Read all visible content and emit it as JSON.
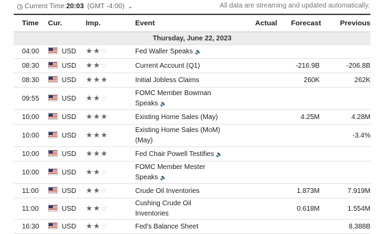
{
  "topbar": {
    "time_label": "Current Time:",
    "time_value": "20:03",
    "timezone": "(GMT -4:00)",
    "chevron": "⌄",
    "notice": "All data are streaming and updated automatically."
  },
  "table": {
    "headers": [
      "Time",
      "Cur.",
      "Imp.",
      "Event",
      "Actual",
      "Forecast",
      "Previous"
    ],
    "date": "Thursday, June 22, 2023",
    "rows": [
      {
        "time": "04:00",
        "cur": "USD",
        "imp": 2,
        "event": "Fed Waller Speaks",
        "speech": true,
        "actual": "",
        "forecast": "",
        "previous": ""
      },
      {
        "time": "08:30",
        "cur": "USD",
        "imp": 2,
        "event": "Current Account (Q1)",
        "speech": false,
        "actual": "",
        "forecast": "-216.9B",
        "previous": "-206.8B"
      },
      {
        "time": "08:30",
        "cur": "USD",
        "imp": 3,
        "event": "Initial Jobless Claims",
        "speech": false,
        "actual": "",
        "forecast": "260K",
        "previous": "262K"
      },
      {
        "time": "09:55",
        "cur": "USD",
        "imp": 2,
        "event": "FOMC Member Bowman Speaks",
        "speech": true,
        "actual": "",
        "forecast": "",
        "previous": ""
      },
      {
        "time": "10:00",
        "cur": "USD",
        "imp": 3,
        "event": "Existing Home Sales (May)",
        "speech": false,
        "actual": "",
        "forecast": "4.25M",
        "previous": "4.28M"
      },
      {
        "time": "10:00",
        "cur": "USD",
        "imp": 3,
        "event": "Existing Home Sales (MoM) (May)",
        "speech": false,
        "actual": "",
        "forecast": "",
        "previous": "-3.4%"
      },
      {
        "time": "10:00",
        "cur": "USD",
        "imp": 3,
        "event": "Fed Chair Powell Testifies",
        "speech": true,
        "actual": "",
        "forecast": "",
        "previous": ""
      },
      {
        "time": "10:00",
        "cur": "USD",
        "imp": 2,
        "event": "FOMC Member Mester Speaks",
        "speech": true,
        "actual": "",
        "forecast": "",
        "previous": ""
      },
      {
        "time": "11:00",
        "cur": "USD",
        "imp": 2,
        "event": "Crude Oil Inventories",
        "speech": false,
        "actual": "",
        "forecast": "1.873M",
        "previous": "7.919M"
      },
      {
        "time": "11:00",
        "cur": "USD",
        "imp": 2,
        "event": "Cushing Crude Oil Inventories",
        "speech": false,
        "actual": "",
        "forecast": "0.618M",
        "previous": "1.554M"
      },
      {
        "time": "16:30",
        "cur": "USD",
        "imp": 2,
        "event": "Fed's Balance Sheet",
        "speech": false,
        "actual": "",
        "forecast": "",
        "previous": "8,388B"
      }
    ]
  },
  "icons": {
    "clock": "clock-icon",
    "flag": "us-flag-icon",
    "star": "star-icon",
    "speaker": "speaker-icon"
  },
  "colors": {
    "star_on": "#666666",
    "star_off": "#cfcfcf"
  }
}
